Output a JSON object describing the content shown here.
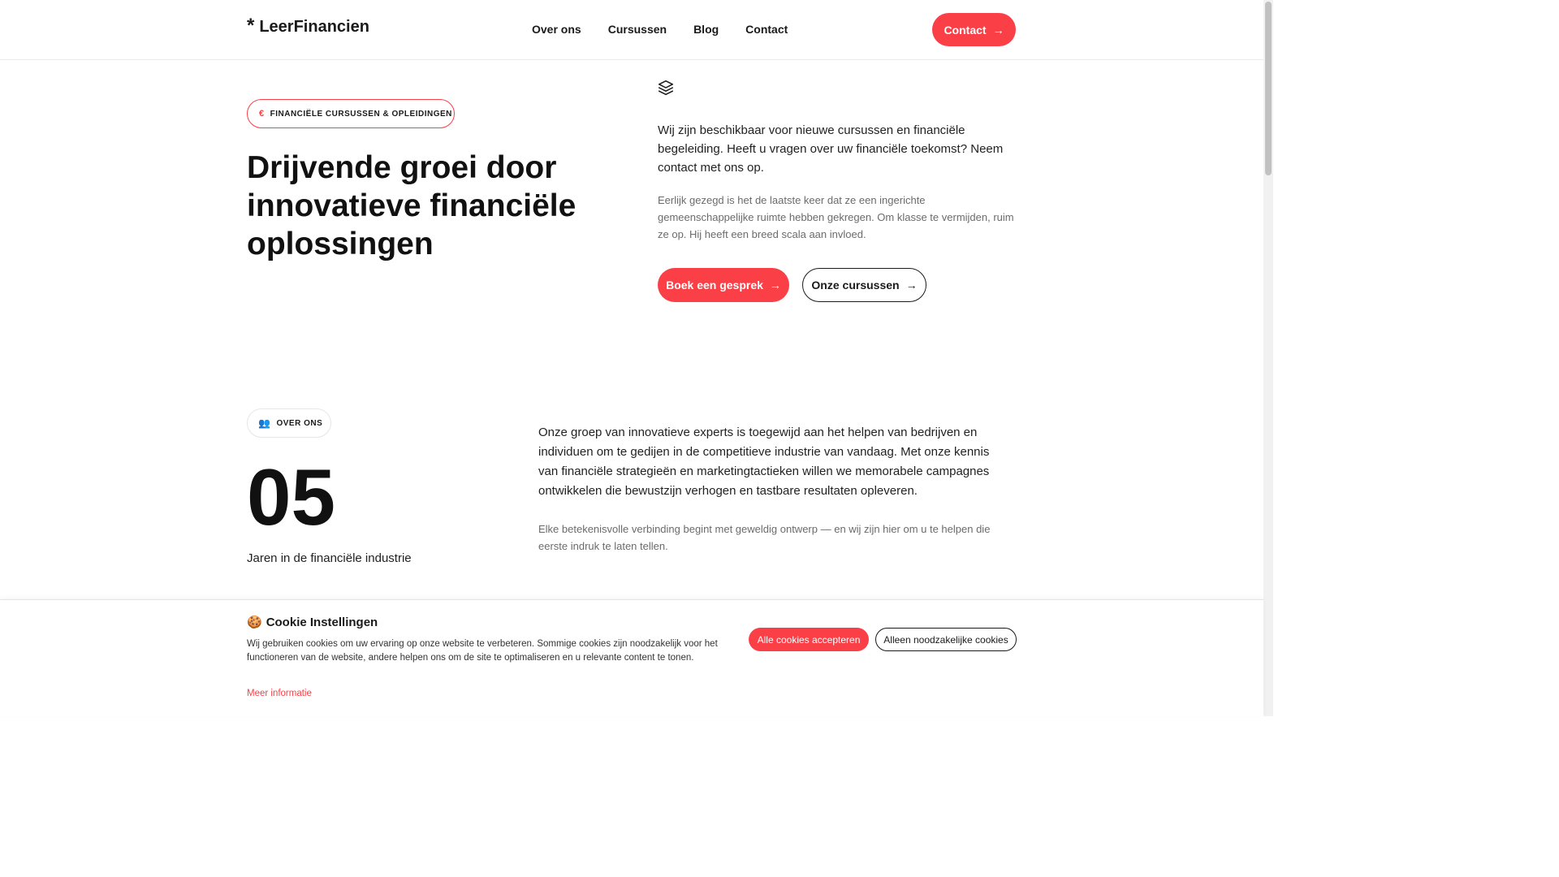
{
  "header": {
    "logo_mark": "*",
    "logo_text": "LeerFinancien",
    "nav": [
      "Over ons",
      "Cursussen",
      "Blog",
      "Contact"
    ],
    "cta_label": "Contact",
    "cta_arrow": "→"
  },
  "hero": {
    "badge_icon": "€",
    "badge_label": "FINANCIËLE CURSUSSEN & OPLEIDINGEN",
    "title": "Drijvende groei door innovatieve financiële oplossingen",
    "icon": "layers-icon",
    "lead": "Wij zijn beschikbaar voor nieuwe cursussen en financiële begeleiding. Heeft u vragen over uw financiële toekomst? Neem contact met ons op.",
    "sub": "Eerlijk gezegd is het de laatste keer dat ze een ingerichte gemeenschappelijke ruimte hebben gekregen. Om klasse te vermijden, ruim ze op. Hij heeft een breed scala aan invloed.",
    "primary_button": "Boek een gesprek",
    "secondary_button": "Onze cursussen",
    "arrow": "→"
  },
  "about": {
    "badge_icon": "👥",
    "badge_label": "OVER ONS",
    "number": "05",
    "number_label": "Jaren in de financiële industrie",
    "lead": "Onze groep van innovatieve experts is toegewijd aan het helpen van bedrijven en individuen om te gedijen in de competitieve industrie van vandaag. Met onze kennis van financiële strategieën en marketingtactieken willen we memorabele campagnes ontwikkelen die bewustzijn verhogen en tastbare resultaten opleveren.",
    "sub": "Elke betekenisvolle verbinding begint met geweldig ontwerp — en wij zijn hier om u te helpen die eerste indruk te laten tellen."
  },
  "cookie": {
    "icon": "🍪",
    "title": "Cookie Instellingen",
    "text": "Wij gebruiken cookies om uw ervaring op onze website te verbeteren. Sommige cookies zijn noodzakelijk voor het functioneren van de website, andere helpen ons om de site te optimaliseren en u relevante content te tonen.",
    "more_link": "Meer informatie",
    "accept_all": "Alle cookies accepteren",
    "necessary_only": "Alleen noodzakelijke cookies"
  },
  "colors": {
    "accent": "#fa3f47",
    "text": "#1a1a1a",
    "muted": "#6b6b6b"
  }
}
